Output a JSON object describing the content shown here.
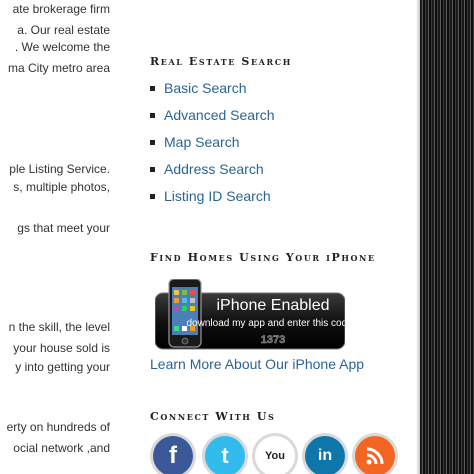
{
  "main_text": [
    "ate brokerage firm",
    "a. Our real estate",
    ". We welcome the",
    "ma City metro area",
    "ple Listing Service.",
    "s, multiple photos,",
    "gs that meet your",
    "n the skill, the level",
    "your house sold is",
    "y into getting your",
    "erty on hundreds of",
    "ocial network ,and"
  ],
  "sidebar": {
    "search_title": "Real Estate Search",
    "search_links": [
      "Basic Search",
      "Advanced Search",
      "Map Search",
      "Address Search",
      "Listing ID Search"
    ],
    "iphone_title": "Find Homes Using Your iPhone",
    "iphone_badge": {
      "heading": "iPhone Enabled",
      "subtext": "download my app and enter this code:",
      "code": "1373"
    },
    "iphone_link": "Learn More About Our iPhone App",
    "connect_title": "Connect With Us",
    "social": [
      {
        "name": "facebook",
        "glyph": "f",
        "color": "#3b5998"
      },
      {
        "name": "twitter",
        "glyph": "t",
        "color": "#33bbee"
      },
      {
        "name": "youtube",
        "glyph": "You",
        "color": "#ffffff"
      },
      {
        "name": "linkedin",
        "glyph": "in",
        "color": "#0e76a8"
      },
      {
        "name": "rss",
        "glyph": "",
        "color": "#f26522"
      }
    ]
  }
}
